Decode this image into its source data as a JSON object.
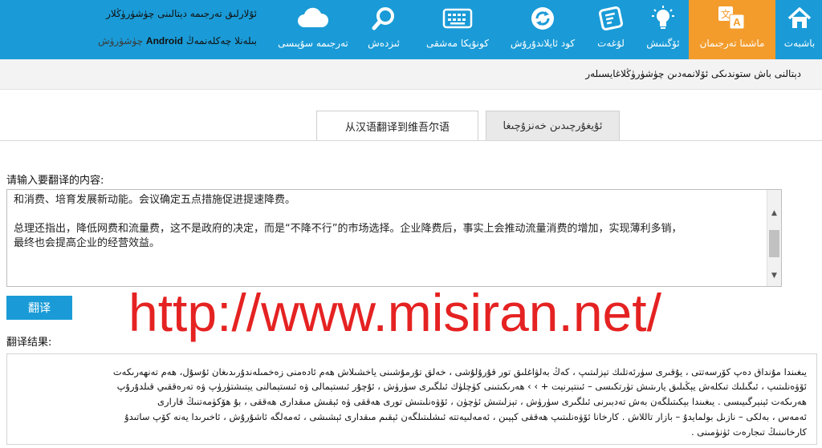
{
  "nav": {
    "items": [
      {
        "label": "باشبەت",
        "icon": "home-icon"
      },
      {
        "label": "ماشىنا تەرجىمان",
        "icon": "translate-icon",
        "active": true
      },
      {
        "label": "ئۆگىنىش",
        "icon": "bulb-icon"
      },
      {
        "label": "لۇغەت",
        "icon": "dictionary-icon"
      },
      {
        "label": "كود ئايلاندۇرۇش",
        "icon": "refresh-icon"
      },
      {
        "label": "كونۇپكا مەشقى",
        "icon": "keyboard-icon"
      },
      {
        "label": "ئىزدەش",
        "icon": "search-icon"
      },
      {
        "label": "تەرجىمە سۇپىسى",
        "icon": "cloud-icon"
      }
    ],
    "promo_line1": "ئۇلارلىق تەرجىمە دېتالىنى چۈشۈرۈڭلار",
    "promo_line2_before": "چۈشۈرۈش",
    "promo_line2_bold": "Android",
    "promo_line2_after": "بىلەنلا چەكلەنمەڭ"
  },
  "subtitle": "دېتالنى باش ستوندىكى ئۆلانمەدىن چۈشۈرۈڭلاغايسىلەر",
  "tabs": [
    {
      "label": "从汉语翻译到维吾尔语",
      "active": true
    },
    {
      "label": "ئۇيغۇرچىدىن خەنزۇچىغا",
      "active": false
    }
  ],
  "input": {
    "label": "请输入要翻译的内容:",
    "line1": "和消费、培育发展新动能。会议确定五点措施促进提速降费。",
    "line2": "总理还指出，降低网费和流量费，这不是政府的决定，而是“不降不行”的市场选择。企业降费后，事实上会推动流量消费的增加，实现薄利多销，",
    "line3": "最终也会提高企业的经营效益。"
  },
  "translate_button": "翻译",
  "watermark": "http://www.misiran.net/",
  "result": {
    "label": "翻译结果:",
    "lines": [
      "يىغىندا مۇنداق دەپ كۆرسەتتى ، يۇقىرى سۈرئەتلىك تېزلىتىپ ، كەڭ بەلۋاغلىق تور قۇرۇلۇشى ، خەلق تۇرمۇشىنى ياخشىلاش ھەم ئادەمنى زەخمىلەندۇرىدىغان ئۇسۇل، ھەم تەنھەرىكەت",
      "ئۆۋەنلىتىپ ، ئىگىلىك تىكلەش يېڭىلىق يارىتىش تۈرتكىسى – ئىنتېرنېت + › › ھەرىكىتىنى كۈچلۈك ئىلگىرى سۈرۈش ، ئۇچۇر ئىستېمالى ۋە ئىستېمالنى يېتىشتۈرۈپ ۋە تەرەققىي قىلدۇرۇپ",
      "ھەرىكەت ئېنېرگىيىسى . يىغىندا بېكىتىلگەن بەش تەدبىرنى ئىلگىرى سۈرۈش ، تېزلىتىش ئۈچۈن ، ئۆۋەنلىتىش تورى ھەققى ۋە ئېقىش مىقدارى ھەققى ، بۇ ھۆكۈمەتنىڭ قارارى",
      "ئەمەس ، بەلكى – نازىل بولمايدۇ – بازار تاللاش . كارخانا ئۆۋەنلىتىپ ھەققى كېيىن ، ئەمەلىيەتتە ئىشلىتىلگەن ئېقىم مىقدارى ئېشىشى ، ئەمەلگە ئاشۇرۇش ، ئاخىرىدا يەنە كۆپ ساتىدۇ",
      "كارخانىنىڭ تىجارەت ئۈنۈمىنى ."
    ]
  }
}
